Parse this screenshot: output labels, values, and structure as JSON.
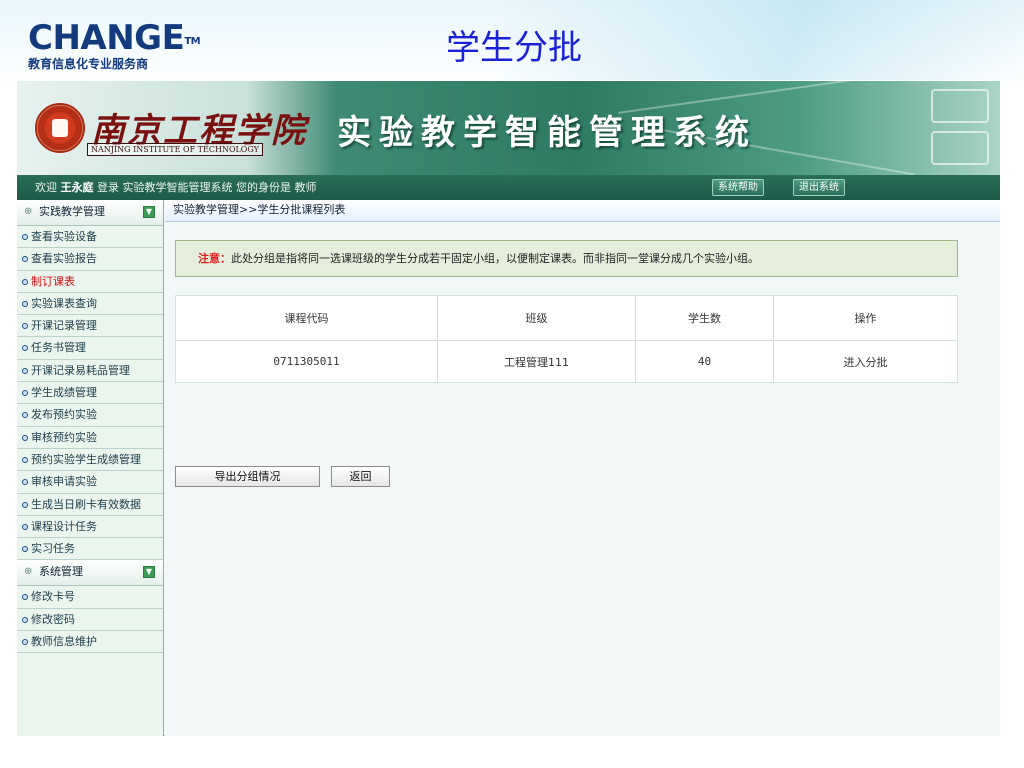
{
  "slide": {
    "brand": "CHANGE",
    "brand_tm": "TM",
    "brand_sub": "教育信息化专业服务商",
    "title": "学生分批"
  },
  "banner": {
    "school_name": "南京工程学院",
    "school_en": "NANJING INSTITUTE OF TECHNOLOGY",
    "system_name": "实验教学智能管理系统"
  },
  "status": {
    "welcome": "欢迎",
    "user": "王永庭",
    "login_text": "登录 实验教学智能管理系统",
    "role_text": "您的身份是 教师",
    "help_label": "系统帮助",
    "logout_label": "退出系统"
  },
  "sidebar": {
    "group1": "实践教学管理",
    "items1": [
      {
        "label": "查看实验设备",
        "active": false
      },
      {
        "label": "查看实验报告",
        "active": false
      },
      {
        "label": "制订课表",
        "active": true
      },
      {
        "label": "实验课表查询",
        "active": false
      },
      {
        "label": "开课记录管理",
        "active": false
      },
      {
        "label": "任务书管理",
        "active": false
      },
      {
        "label": "开课记录易耗品管理",
        "active": false
      },
      {
        "label": "学生成绩管理",
        "active": false
      },
      {
        "label": "发布预约实验",
        "active": false
      },
      {
        "label": "审核预约实验",
        "active": false
      },
      {
        "label": "预约实验学生成绩管理",
        "active": false
      },
      {
        "label": "审核申请实验",
        "active": false
      },
      {
        "label": "生成当日刷卡有效数据",
        "active": false
      },
      {
        "label": "课程设计任务",
        "active": false
      },
      {
        "label": "实习任务",
        "active": false
      }
    ],
    "group2": "系统管理",
    "items2": [
      {
        "label": "修改卡号"
      },
      {
        "label": "修改密码"
      },
      {
        "label": "教师信息维护"
      }
    ]
  },
  "content": {
    "breadcrumb": "实验教学管理>>学生分批课程列表",
    "notice_label": "注意：",
    "notice_text": "此处分组是指将同一选课班级的学生分成若干固定小组，以便制定课表。而非指同一堂课分成几个实验小组。",
    "table": {
      "headers": [
        "课程代码",
        "班级",
        "学生数",
        "操作"
      ],
      "rows": [
        [
          "0711305011",
          "工程管理111",
          "40",
          "进入分批"
        ]
      ]
    },
    "export_button": "导出分组情况",
    "back_button": "返回"
  },
  "colors": {
    "slide_title": "#1a22d8",
    "brand": "#123a7d",
    "status_bar": "#1e5a49",
    "notice_label": "#e02020",
    "active_item": "#d01010"
  }
}
